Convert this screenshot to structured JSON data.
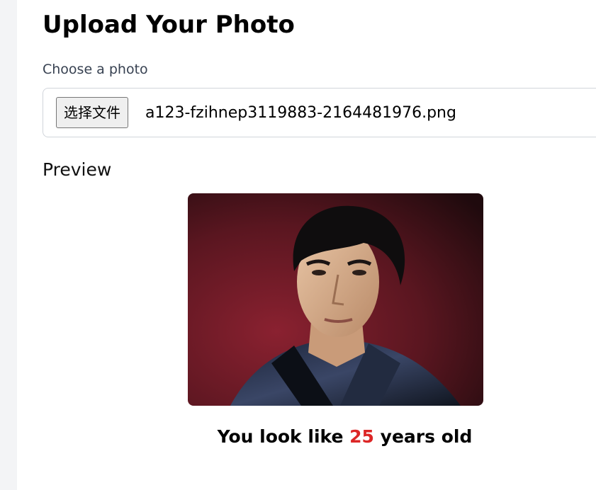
{
  "page": {
    "title": "Upload Your Photo",
    "choose_label": "Choose a photo",
    "preview_label": "Preview"
  },
  "file_input": {
    "button_label": "选择文件",
    "file_name": "a123-fzihnep3119883-2164481976.png"
  },
  "result": {
    "prefix": "You look like",
    "age": "25",
    "suffix": "years old",
    "age_color": "#dc2626"
  },
  "colors": {
    "page_background": "#f3f4f6",
    "card_background": "#ffffff",
    "photo_background": "#7a1f2a"
  }
}
